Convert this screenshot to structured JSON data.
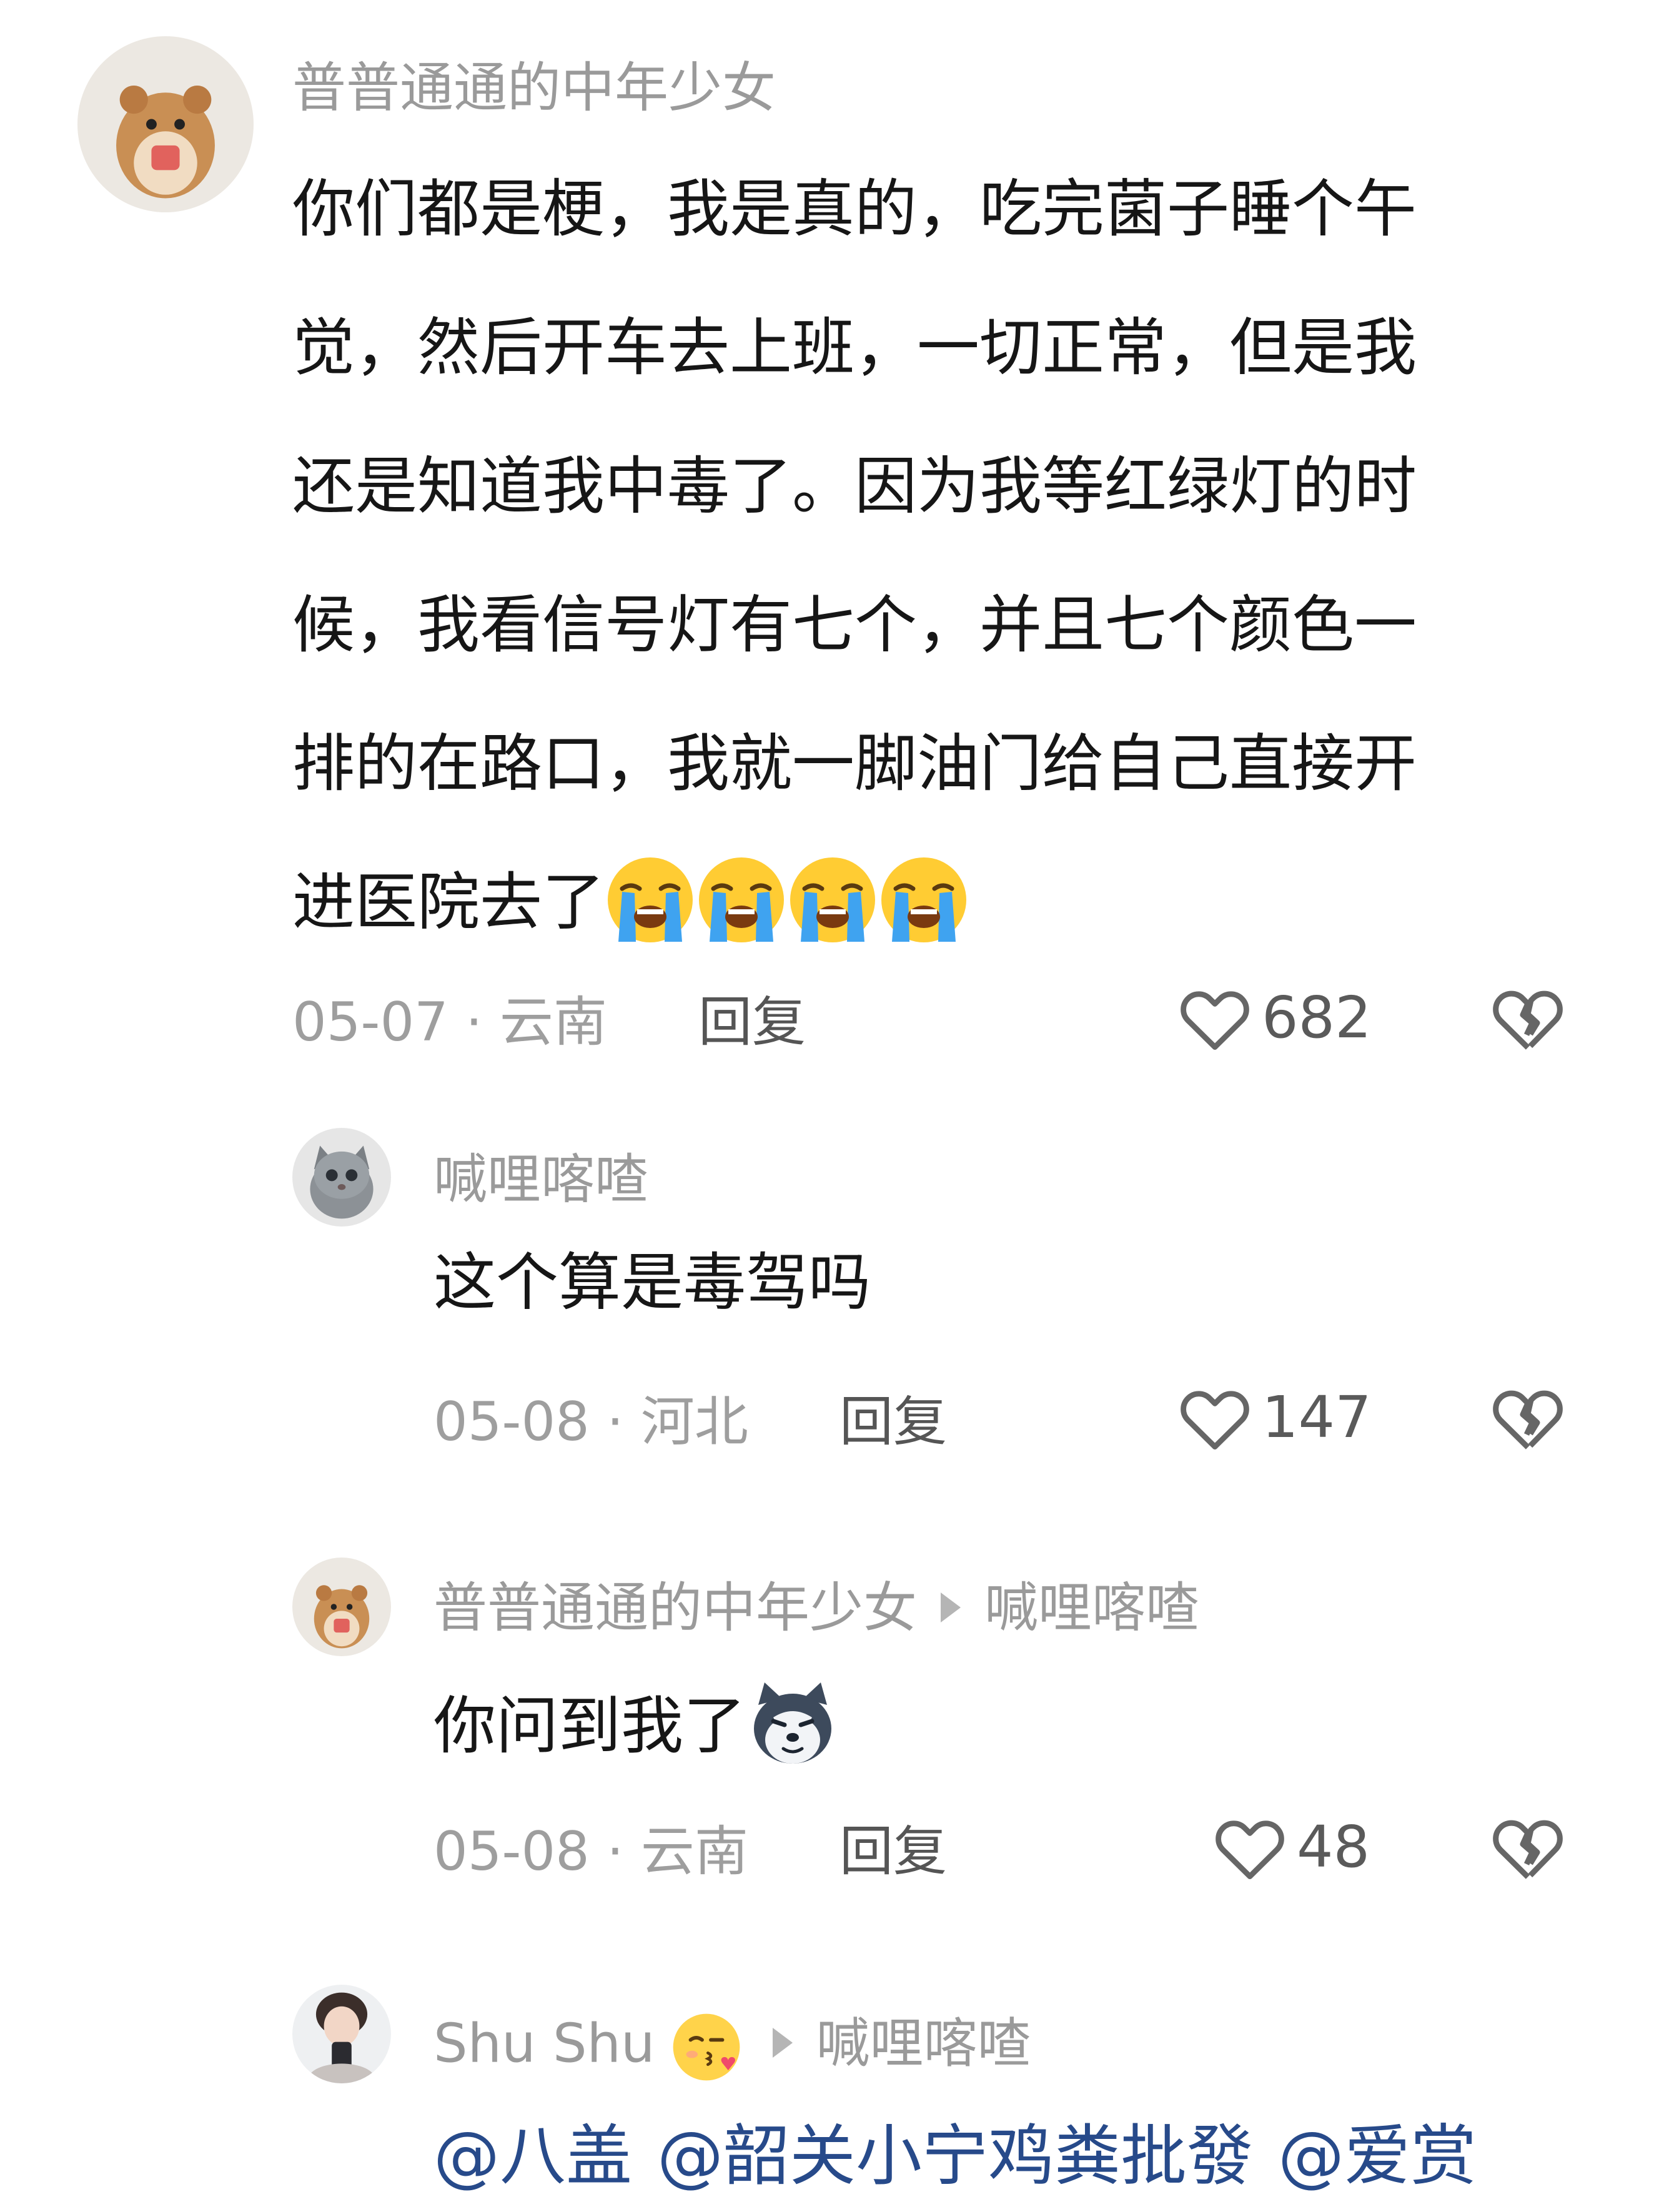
{
  "comments": [
    {
      "username": "普普通通的中年少女",
      "avatar": "hamster-avatar",
      "lines": [
        "你们都是梗，我是真的，吃完菌子睡个午",
        "觉，然后开车去上班，一切正常，但是我",
        "还是知道我中毒了。因为我等红绿灯的时",
        "候，我看信号灯有七个，并且七个颜色一",
        "排的在路口，我就一脚油门给自己直接开",
        "进医院去了"
      ],
      "trailing_emoji": "loudly-crying-face",
      "trailing_emoji_count": 4,
      "date": "05-07",
      "location": "云南",
      "meta": "05-07 · 云南",
      "reply_label": "回复",
      "likes": "682"
    },
    {
      "username": "喊哩喀喳",
      "avatar": "grey-cat-avatar",
      "text": "这个算是毒驾吗",
      "meta": "05-08 · 河北",
      "reply_label": "回复",
      "likes": "147"
    },
    {
      "username": "普普通通的中年少女",
      "reply_to": "喊哩喀喳",
      "avatar": "hamster-avatar",
      "text": "你问到我了",
      "trailing_emoji": "husky-dog-face",
      "meta": "05-08 · 云南",
      "reply_label": "回复",
      "likes": "48"
    },
    {
      "username": "Shu Shu",
      "username_emoji": "face-blowing-kiss",
      "reply_to": "喊哩喀喳",
      "avatar": "person-selfie-avatar",
      "mentions": [
        "@八盖",
        "@韶关小宁鸡粪批發",
        "@爱赏"
      ]
    }
  ],
  "colors": {
    "meta_gray": "#9e9e9e",
    "mention_blue": "#274a8a",
    "text": "#161616"
  }
}
